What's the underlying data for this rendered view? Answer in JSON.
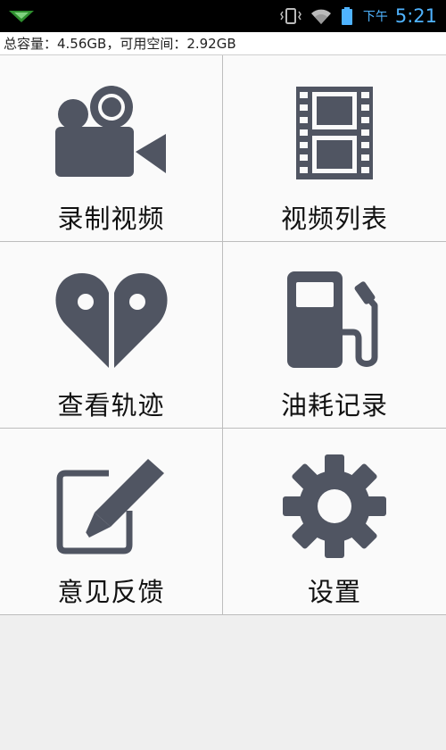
{
  "status_bar": {
    "time_period": "下午",
    "time": "5:21",
    "icons": [
      "signal-app-icon",
      "vibrate-icon",
      "wifi-icon",
      "battery-icon"
    ]
  },
  "storage": {
    "text": "总容量：4.56GB，可用空间：2.92GB"
  },
  "menu": [
    {
      "label": "录制视频",
      "icon": "video-camera-icon"
    },
    {
      "label": "视频列表",
      "icon": "film-strip-icon"
    },
    {
      "label": "查看轨迹",
      "icon": "location-heart-icon"
    },
    {
      "label": "油耗记录",
      "icon": "fuel-pump-icon"
    },
    {
      "label": "意见反馈",
      "icon": "edit-pen-icon"
    },
    {
      "label": "设置",
      "icon": "gear-icon"
    }
  ],
  "colors": {
    "icon": "#505562",
    "status_bar": "#000000",
    "status_accent": "#4fb3ff",
    "background": "#f2f2f2"
  }
}
